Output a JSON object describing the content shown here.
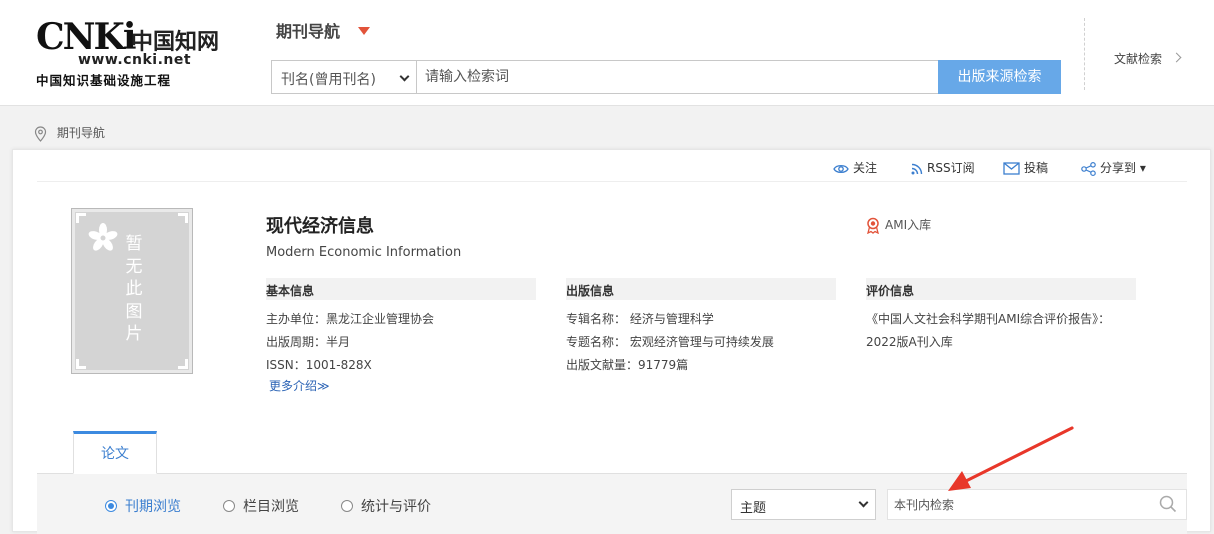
{
  "logo": {
    "mark": "CNKi",
    "cn_name": "中国知网",
    "url": "www.cnki.net",
    "tagline": "中国知识基础设施工程"
  },
  "header": {
    "nav_title": "期刊导航",
    "search_type": "刊名(曾用刊名)",
    "search_placeholder": "请输入检索词",
    "search_button": "出版来源检索",
    "lit_search": "文献检索"
  },
  "breadcrumb": {
    "label": "期刊导航"
  },
  "actions": {
    "follow": "关注",
    "rss": "RSS订阅",
    "submit": "投稿",
    "share": "分享到 ▾"
  },
  "cover": {
    "placeholder_text": [
      "暂",
      "无",
      "此",
      "图",
      "片"
    ]
  },
  "journal": {
    "title": "现代经济信息",
    "en_title": "Modern Economic Information",
    "ami_badge": "AMI入库"
  },
  "basic_info": {
    "heading": "基本信息",
    "sponsor": "主办单位：黑龙江企业管理协会",
    "cycle": "出版周期：半月",
    "issn": "ISSN：1001-828X",
    "more": "更多介绍≫"
  },
  "pub_info": {
    "heading": "出版信息",
    "series": "专辑名称：  经济与管理科学",
    "topic": "专题名称：  宏观经济管理与可持续发展",
    "count": "出版文献量：91779篇"
  },
  "eval_info": {
    "heading": "评价信息",
    "line1": "《中国人文社会科学期刊AMI综合评价报告》：",
    "line2": "2022版A刊入库"
  },
  "tabs": {
    "papers": "论文"
  },
  "filter": {
    "by_issue": "刊期浏览",
    "by_column": "栏目浏览",
    "stats": "统计与评价",
    "field": "主题",
    "in_journal_placeholder": "本刊内检索"
  },
  "colors": {
    "accent_blue": "#3c8ae0",
    "button_blue": "#67a8e8",
    "caret_red": "#e2533a",
    "annotation_red": "#e8372a"
  }
}
